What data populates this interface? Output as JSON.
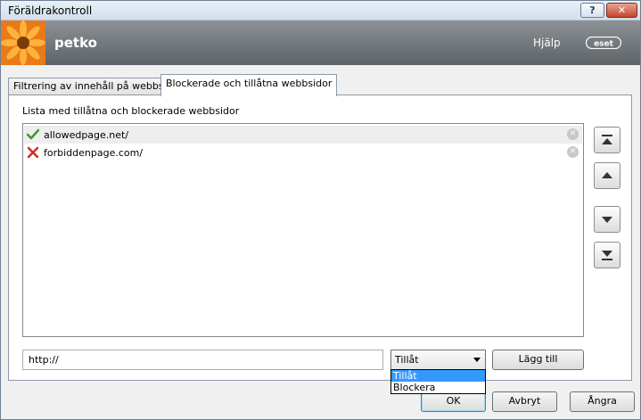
{
  "window": {
    "title": "Föräldrakontroll"
  },
  "titlebar": {
    "help_button": "?",
    "close_button": "✕"
  },
  "header": {
    "user": "petko",
    "help": "Hjälp",
    "brand": "eset"
  },
  "tabs": [
    {
      "label": "Filtrering av innehåll på webbsida",
      "active": false
    },
    {
      "label": "Blockerade och tillåtna webbsidor",
      "active": true
    }
  ],
  "list": {
    "label": "Lista med tillåtna och blockerade webbsidor",
    "items": [
      {
        "url": "allowedpage.net/",
        "status": "allowed",
        "status_icon": "checkmark-icon"
      },
      {
        "url": "forbiddenpage.com/",
        "status": "blocked",
        "status_icon": "red-x-icon"
      }
    ]
  },
  "side_buttons": [
    "move-to-top-icon",
    "move-up-icon",
    "move-down-icon",
    "move-to-bottom-icon"
  ],
  "input": {
    "value": "http://"
  },
  "select": {
    "value": "Tillåt",
    "options": [
      "Tillåt",
      "Blockera"
    ],
    "highlighted": "Tillåt"
  },
  "buttons": {
    "add": "Lägg till",
    "ok": "OK",
    "cancel": "Avbryt",
    "undo": "Ångra"
  },
  "colors": {
    "accent": "#3399ff",
    "allowed": "#3c9a2b",
    "blocked": "#d42a1e"
  }
}
